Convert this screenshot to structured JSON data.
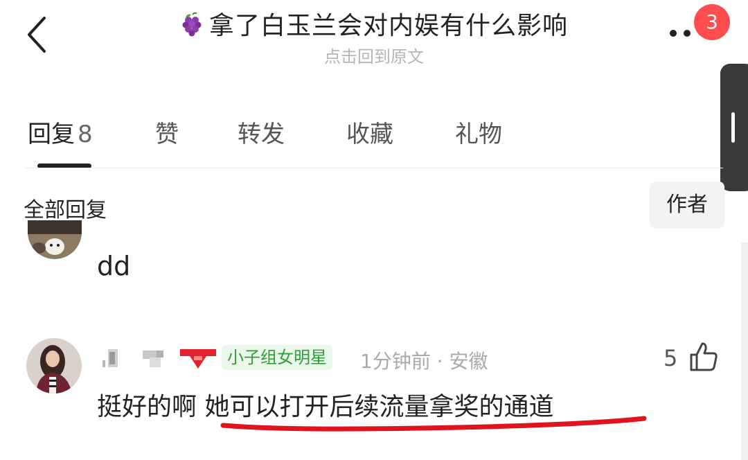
{
  "header": {
    "title_emoji": "🍇",
    "title": "拿了白玉兰会对内娱有什么影响",
    "subtitle": "点击回到原文",
    "notification_count": "3"
  },
  "tabs": [
    {
      "label": "回复",
      "count": "8",
      "active": true
    },
    {
      "label": "赞"
    },
    {
      "label": "转发"
    },
    {
      "label": "收藏"
    },
    {
      "label": "礼物"
    }
  ],
  "filter": {
    "all_label": "全部回复",
    "author_label": "作者"
  },
  "comments": [
    {
      "text": "dd"
    },
    {
      "user_tag": "小子组女明星",
      "time": "1分钟前",
      "separator": "·",
      "location": "安徽",
      "likes": "5",
      "text_plain": "挺好的啊 ",
      "text_highlight": "她可以打开后续流量拿奖的通道"
    }
  ],
  "colors": {
    "badge": "#ff4d4f",
    "tag_bg": "#eaf7ea",
    "tag_text": "#2f9d3a",
    "underline": "#e0141e",
    "scroll_handle": "#3a3a3a"
  }
}
